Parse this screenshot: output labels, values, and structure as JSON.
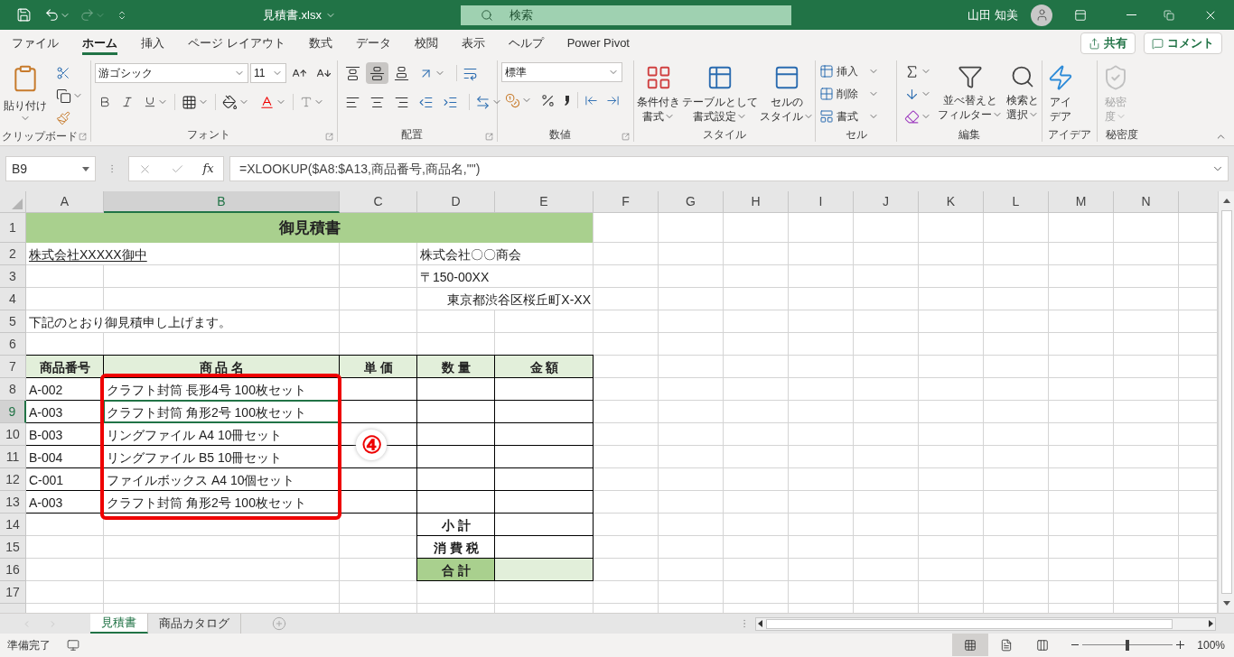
{
  "title_bar": {
    "file_name": "見積書.xlsx",
    "search": {
      "placeholder": "検索"
    },
    "user": "山田 知美"
  },
  "ribbon_tabs": [
    {
      "label": "ファイル",
      "selected": false
    },
    {
      "label": "ホーム",
      "selected": true
    },
    {
      "label": "挿入",
      "selected": false
    },
    {
      "label": "ページ レイアウト",
      "selected": false
    },
    {
      "label": "数式",
      "selected": false
    },
    {
      "label": "データ",
      "selected": false
    },
    {
      "label": "校閲",
      "selected": false
    },
    {
      "label": "表示",
      "selected": false
    },
    {
      "label": "ヘルプ",
      "selected": false
    },
    {
      "label": "Power Pivot",
      "selected": false
    }
  ],
  "ribbon_actions": [
    {
      "kind": "share",
      "label": "共有"
    },
    {
      "kind": "comment",
      "label": "コメント"
    }
  ],
  "ribbon_groups": [
    {
      "kind": "clipboard",
      "label": "クリップボード",
      "paste": "貼り付け"
    },
    {
      "kind": "font",
      "label": "フォント",
      "font": "游ゴシック",
      "size": "11"
    },
    {
      "kind": "alignment",
      "label": "配置",
      "vertical_align": [
        {
          "kind": "top",
          "selected": false
        },
        {
          "kind": "middle",
          "selected": true
        },
        {
          "kind": "bottom",
          "selected": false
        }
      ]
    },
    {
      "kind": "number",
      "label": "数値",
      "format": "標準"
    },
    {
      "kind": "styles",
      "label": "スタイル",
      "buttons": [
        [
          "条件付き",
          "書式"
        ],
        [
          "テーブルとして",
          "書式設定"
        ],
        [
          "セルの",
          "スタイル"
        ]
      ]
    },
    {
      "kind": "cells",
      "label": "セル",
      "buttons": [
        "挿入",
        "削除",
        "書式"
      ]
    },
    {
      "kind": "editing",
      "label": "編集",
      "buttons": [
        [
          "並べ替えと",
          "フィルター"
        ],
        [
          "検索と",
          "選択"
        ]
      ]
    },
    {
      "kind": "ideas",
      "label": "アイデア",
      "buttons": [
        [
          "アイ",
          "デア"
        ]
      ]
    },
    {
      "kind": "sensitivity",
      "label": "秘密度",
      "disabled": true,
      "buttons": [
        [
          "秘密",
          "度"
        ]
      ]
    }
  ],
  "formula_bar": {
    "name_box": "B9",
    "function_label": "fx",
    "formula": "=XLOOKUP($A8:$A13,商品番号,商品名,\"\")"
  },
  "sheet": {
    "columns": [
      {
        "label": "A",
        "selected": false
      },
      {
        "label": "B",
        "selected": true
      },
      {
        "label": "C",
        "selected": false
      },
      {
        "label": "D",
        "selected": false
      },
      {
        "label": "E",
        "selected": false
      },
      {
        "label": "F",
        "selected": false
      },
      {
        "label": "G",
        "selected": false
      },
      {
        "label": "H",
        "selected": false
      },
      {
        "label": "I",
        "selected": false
      },
      {
        "label": "J",
        "selected": false
      },
      {
        "label": "K",
        "selected": false
      },
      {
        "label": "L",
        "selected": false
      },
      {
        "label": "M",
        "selected": false
      },
      {
        "label": "N",
        "selected": false
      }
    ],
    "rows": [
      {
        "number": "1",
        "selected": false,
        "cells": [
          {
            "kind": "title",
            "text": "御見積書"
          },
          {
            "kind": "merged"
          },
          {
            "kind": "merged"
          },
          {
            "kind": "merged"
          },
          {
            "kind": "merged"
          }
        ]
      },
      {
        "number": "2",
        "selected": false,
        "cells": [
          {
            "kind": "underline",
            "text": "株式会社XXXXX御中"
          },
          {
            "kind": "merged"
          },
          {
            "kind": "blank"
          },
          {
            "kind": "text",
            "text": "株式会社〇〇商会"
          },
          {
            "kind": "merged"
          }
        ]
      },
      {
        "number": "3",
        "selected": false,
        "cells": [
          {
            "kind": "blank"
          },
          {
            "kind": "blank"
          },
          {
            "kind": "blank"
          },
          {
            "kind": "text",
            "text": "〒150-00XX"
          },
          {
            "kind": "merged"
          }
        ]
      },
      {
        "number": "4",
        "selected": false,
        "cells": [
          {
            "kind": "blank"
          },
          {
            "kind": "blank"
          },
          {
            "kind": "blank"
          },
          {
            "kind": "right",
            "text": "東京都渋谷区桜丘町X-XX"
          },
          {
            "kind": "merged"
          }
        ]
      },
      {
        "number": "5",
        "selected": false,
        "cells": [
          {
            "kind": "text",
            "text": "下記のとおり御見積申し上げます。"
          },
          {
            "kind": "merged"
          }
        ]
      },
      {
        "number": "6",
        "selected": false
      },
      {
        "number": "7",
        "selected": false,
        "cells": [
          {
            "kind": "header",
            "text": "商品番号"
          },
          {
            "kind": "header",
            "text": "商 品 名"
          },
          {
            "kind": "header",
            "text": "単 価"
          },
          {
            "kind": "header",
            "text": "数 量"
          },
          {
            "kind": "header",
            "text": "金 額"
          }
        ]
      },
      {
        "number": "8",
        "selected": false,
        "cells": [
          {
            "kind": "cell",
            "text": "A-002"
          },
          {
            "kind": "cell",
            "text": "クラフト封筒 長形4号 100枚セット"
          },
          {
            "kind": "cell"
          },
          {
            "kind": "cell"
          },
          {
            "kind": "cell"
          }
        ]
      },
      {
        "number": "9",
        "selected": true,
        "cells": [
          {
            "kind": "cell",
            "text": "A-003"
          },
          {
            "kind": "cell",
            "text": "クラフト封筒 角形2号 100枚セット"
          },
          {
            "kind": "cell"
          },
          {
            "kind": "cell"
          },
          {
            "kind": "cell"
          }
        ]
      },
      {
        "number": "10",
        "selected": false,
        "cells": [
          {
            "kind": "cell",
            "text": "B-003"
          },
          {
            "kind": "cell",
            "text": "リングファイル A4 10冊セット"
          },
          {
            "kind": "cell"
          },
          {
            "kind": "cell"
          },
          {
            "kind": "cell"
          }
        ]
      },
      {
        "number": "11",
        "selected": false,
        "cells": [
          {
            "kind": "cell",
            "text": "B-004"
          },
          {
            "kind": "cell",
            "text": "リングファイル B5 10冊セット"
          },
          {
            "kind": "cell"
          },
          {
            "kind": "cell"
          },
          {
            "kind": "cell"
          }
        ]
      },
      {
        "number": "12",
        "selected": false,
        "cells": [
          {
            "kind": "cell",
            "text": "C-001"
          },
          {
            "kind": "cell",
            "text": "ファイルボックス A4 10個セット"
          },
          {
            "kind": "cell"
          },
          {
            "kind": "cell"
          },
          {
            "kind": "cell"
          }
        ]
      },
      {
        "number": "13",
        "selected": false,
        "cells": [
          {
            "kind": "cell",
            "text": "A-003"
          },
          {
            "kind": "cell",
            "text": "クラフト封筒 角形2号 100枚セット"
          },
          {
            "kind": "cell"
          },
          {
            "kind": "cell"
          },
          {
            "kind": "cell"
          }
        ]
      },
      {
        "number": "14",
        "selected": false,
        "cells": [
          {
            "kind": "blank"
          },
          {
            "kind": "blank"
          },
          {
            "kind": "blank"
          },
          {
            "kind": "label",
            "text": "小 計"
          },
          {
            "kind": "cell"
          }
        ]
      },
      {
        "number": "15",
        "selected": false,
        "cells": [
          {
            "kind": "blank"
          },
          {
            "kind": "blank"
          },
          {
            "kind": "blank"
          },
          {
            "kind": "label",
            "text": "消 費 税"
          },
          {
            "kind": "cell"
          }
        ]
      },
      {
        "number": "16",
        "selected": false,
        "cells": [
          {
            "kind": "blank"
          },
          {
            "kind": "blank"
          },
          {
            "kind": "blank"
          },
          {
            "kind": "total_label",
            "text": "合 計"
          },
          {
            "kind": "total_value"
          }
        ]
      },
      {
        "number": "17",
        "selected": false
      }
    ]
  },
  "annotation": {
    "kind": "outline",
    "label": "④"
  },
  "sheet_tabs": [
    {
      "label": "見積書",
      "selected": true
    },
    {
      "label": "商品カタログ",
      "selected": false
    }
  ],
  "status_bar": {
    "text": "準備完了",
    "views": [
      {
        "kind": "normal",
        "selected": true
      },
      {
        "kind": "page_layout",
        "selected": false
      },
      {
        "kind": "page_break",
        "selected": false
      }
    ],
    "zoom": {
      "level": 0.5,
      "reading": "100%"
    }
  }
}
